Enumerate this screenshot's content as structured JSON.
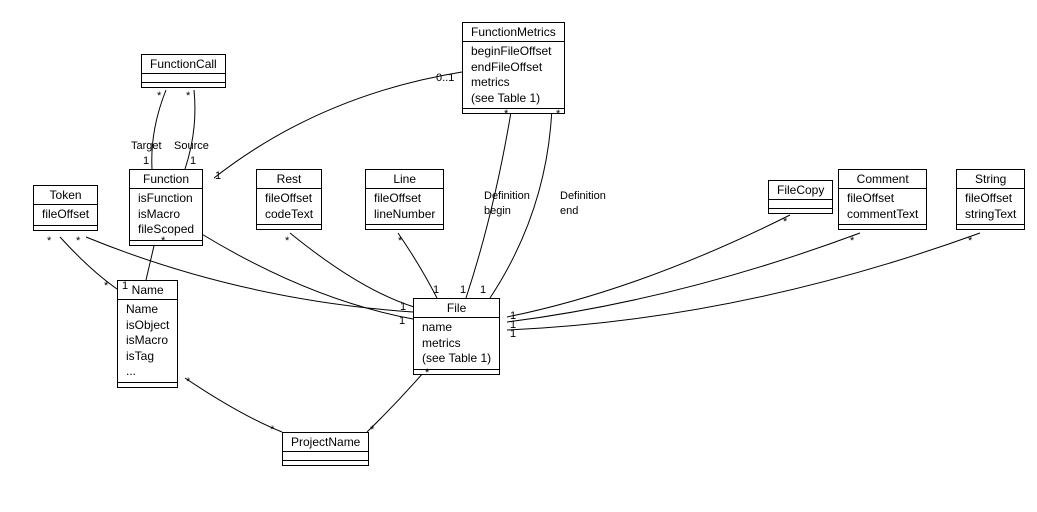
{
  "classes": {
    "FunctionCall": {
      "title": "FunctionCall",
      "attrs": []
    },
    "FunctionMetrics": {
      "title": "FunctionMetrics",
      "attrs": [
        "beginFileOffset",
        "endFileOffset",
        "metrics",
        "(see Table 1)"
      ]
    },
    "Token": {
      "title": "Token",
      "attrs": [
        "fileOffset"
      ]
    },
    "Function": {
      "title": "Function",
      "attrs": [
        "isFunction",
        "isMacro",
        "fileScoped"
      ]
    },
    "Rest": {
      "title": "Rest",
      "attrs": [
        "fileOffset",
        "codeText"
      ]
    },
    "Line": {
      "title": "Line",
      "attrs": [
        "fileOffset",
        "lineNumber"
      ]
    },
    "FileCopy": {
      "title": "FileCopy",
      "attrs": []
    },
    "Comment": {
      "title": "Comment",
      "attrs": [
        "fileOffset",
        "commentText"
      ]
    },
    "String": {
      "title": "String",
      "attrs": [
        "fileOffset",
        "stringText"
      ]
    },
    "Name": {
      "title": "Name",
      "attrs": [
        "Name",
        "isObject",
        "isMacro",
        "isTag",
        "..."
      ]
    },
    "File": {
      "title": "File",
      "attrs": [
        "name",
        "metrics",
        "(see Table 1)"
      ]
    },
    "ProjectName": {
      "title": "ProjectName",
      "attrs": []
    }
  },
  "labels": {
    "target": "Target",
    "source": "Source",
    "definition": "Definition",
    "begin": "begin",
    "end": "end",
    "zeroOne": "0..1",
    "one": "1",
    "star": "*"
  },
  "chart_data": {
    "type": "uml-class-diagram",
    "classes": [
      {
        "name": "FunctionCall",
        "attributes": []
      },
      {
        "name": "FunctionMetrics",
        "attributes": [
          "beginFileOffset",
          "endFileOffset",
          "metrics",
          "(see Table 1)"
        ]
      },
      {
        "name": "Token",
        "attributes": [
          "fileOffset"
        ]
      },
      {
        "name": "Function",
        "attributes": [
          "isFunction",
          "isMacro",
          "fileScoped"
        ]
      },
      {
        "name": "Rest",
        "attributes": [
          "fileOffset",
          "codeText"
        ]
      },
      {
        "name": "Line",
        "attributes": [
          "fileOffset",
          "lineNumber"
        ]
      },
      {
        "name": "FileCopy",
        "attributes": []
      },
      {
        "name": "Comment",
        "attributes": [
          "fileOffset",
          "commentText"
        ]
      },
      {
        "name": "String",
        "attributes": [
          "fileOffset",
          "stringText"
        ]
      },
      {
        "name": "Name",
        "attributes": [
          "Name",
          "isObject",
          "isMacro",
          "isTag",
          "..."
        ]
      },
      {
        "name": "File",
        "attributes": [
          "name",
          "metrics",
          "(see Table 1)"
        ]
      },
      {
        "name": "ProjectName",
        "attributes": []
      }
    ],
    "associations": [
      {
        "from": "FunctionCall",
        "to": "Function",
        "roles": {
          "to": "Target"
        },
        "mult": {
          "from": "*",
          "to": "1"
        }
      },
      {
        "from": "FunctionCall",
        "to": "Function",
        "roles": {
          "to": "Source"
        },
        "mult": {
          "from": "*",
          "to": "1"
        }
      },
      {
        "from": "FunctionMetrics",
        "to": "Function",
        "mult": {
          "from": "0..1",
          "to": "1"
        }
      },
      {
        "from": "FunctionMetrics",
        "to": "File",
        "roles": {
          "from": "Definition begin"
        },
        "mult": {
          "from": "*",
          "to": "1"
        }
      },
      {
        "from": "FunctionMetrics",
        "to": "File",
        "roles": {
          "from": "Definition end"
        },
        "mult": {
          "from": "*",
          "to": "1"
        }
      },
      {
        "from": "Function",
        "to": "Name",
        "mult": {
          "from": "*",
          "to": "1"
        }
      },
      {
        "from": "Token",
        "to": "Name",
        "mult": {
          "from": "*",
          "to": "*"
        }
      },
      {
        "from": "Token",
        "to": "File",
        "mult": {
          "from": "*",
          "to": "1"
        }
      },
      {
        "from": "Rest",
        "to": "File",
        "mult": {
          "from": "*",
          "to": "1"
        }
      },
      {
        "from": "Line",
        "to": "File",
        "mult": {
          "from": "*",
          "to": "1"
        }
      },
      {
        "from": "FileCopy",
        "to": "File",
        "mult": {
          "from": "*",
          "to": "1"
        }
      },
      {
        "from": "Comment",
        "to": "File",
        "mult": {
          "from": "*",
          "to": "1"
        }
      },
      {
        "from": "String",
        "to": "File",
        "mult": {
          "from": "*",
          "to": "1"
        }
      },
      {
        "from": "Name",
        "to": "ProjectName",
        "mult": {
          "from": "*",
          "to": "*"
        }
      },
      {
        "from": "File",
        "to": "ProjectName",
        "mult": {
          "from": "*",
          "to": "*"
        }
      }
    ]
  }
}
